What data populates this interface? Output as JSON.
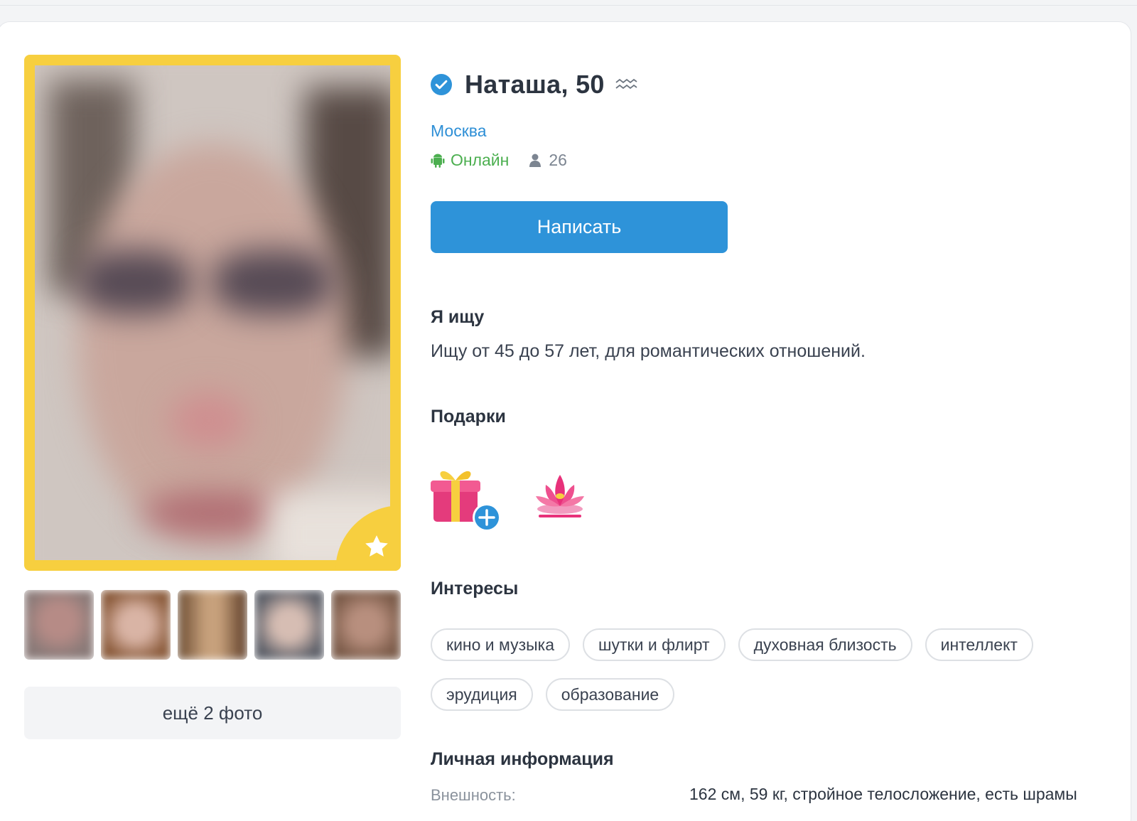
{
  "profile": {
    "name": "Наташа, 50",
    "city": "Москва",
    "status": "Онлайн",
    "views": "26",
    "write_button": "Написать",
    "more_photos": "ещё 2 фото"
  },
  "sections": {
    "looking_title": "Я ищу",
    "looking_text": "Ищу от 45 до 57 лет, для романтических отношений.",
    "gifts_title": "Подарки",
    "interests_title": "Интересы",
    "personal_title": "Личная информация"
  },
  "gifts": [
    {
      "icon": "gift-box-add-icon"
    },
    {
      "icon": "lotus-flower-gift-icon"
    }
  ],
  "interests": [
    "кино и музыка",
    "шутки и флирт",
    "духовная близость",
    "интеллект",
    "эрудиция",
    "образование"
  ],
  "personal_info": {
    "appearance_label": "Внешность:",
    "appearance_value": "162 см, 59 кг, стройное телосложение, есть шрамы"
  },
  "colors": {
    "accent_blue": "#2e93d9",
    "online_green": "#4caf50",
    "photo_frame_yellow": "#f7cf3f"
  }
}
